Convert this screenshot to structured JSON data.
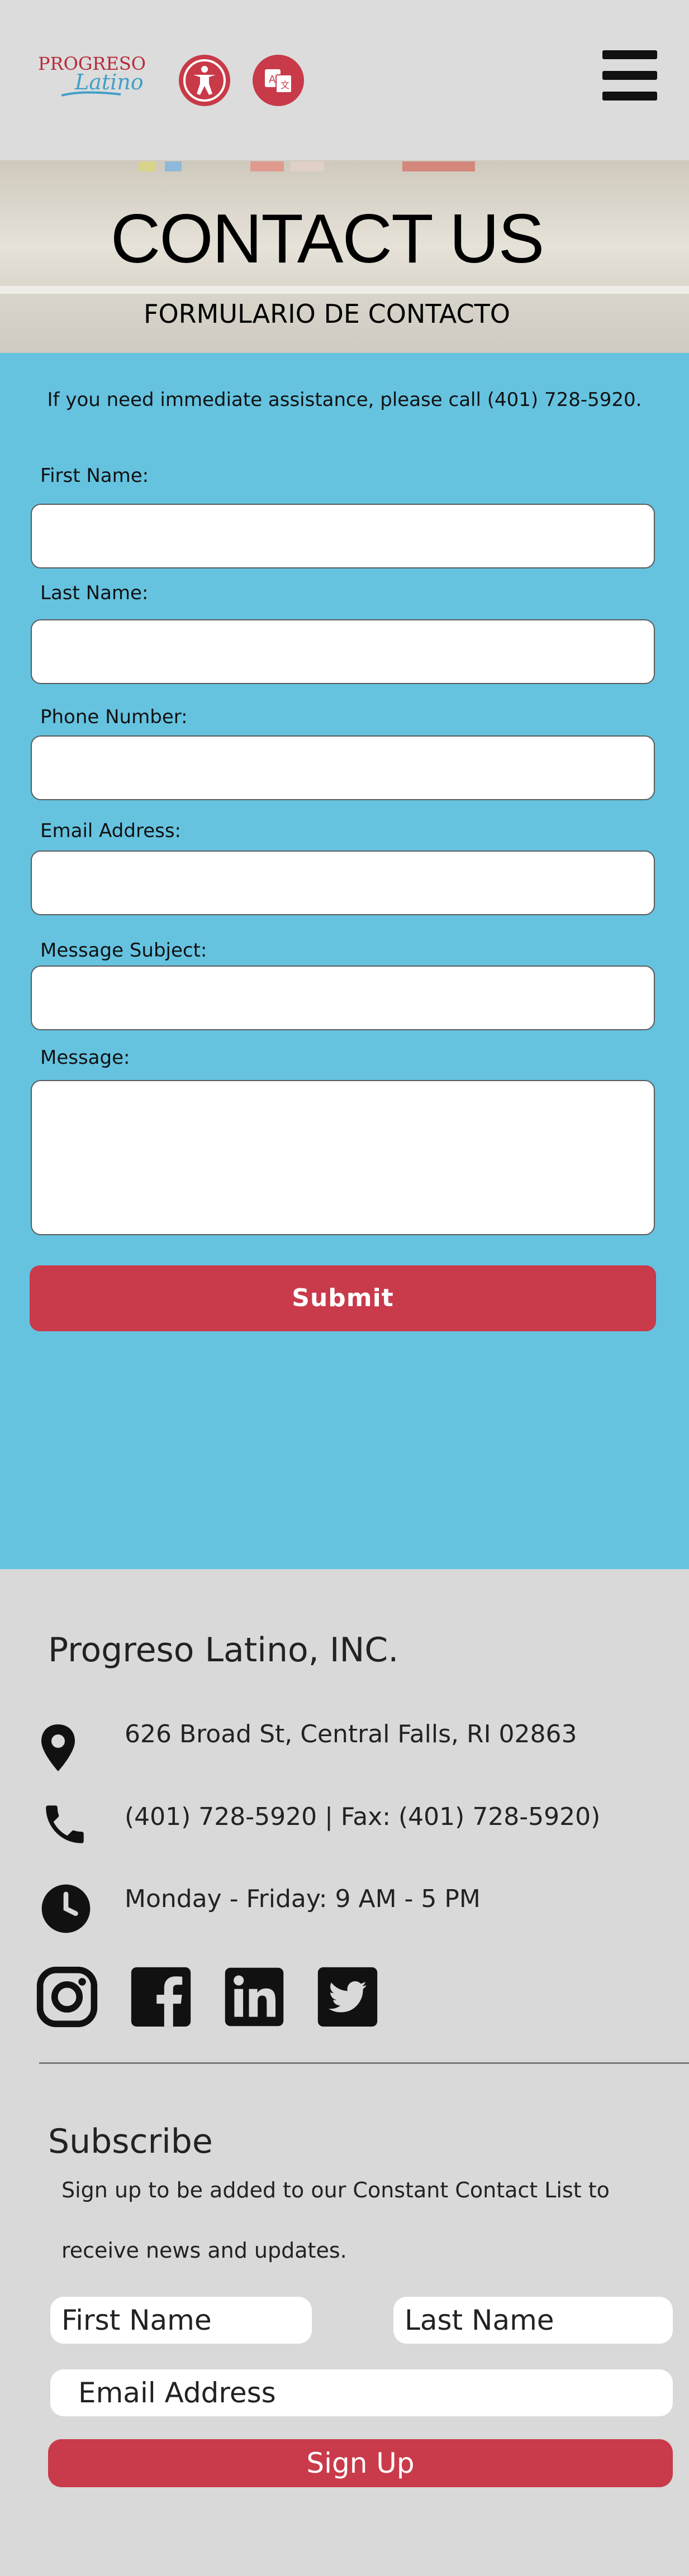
{
  "header": {
    "logo_top": "PROGRESO",
    "logo_bottom": "Latino",
    "accessibility_icon": "accessibility-icon",
    "translate_icon": "translate-icon",
    "menu_icon": "hamburger-menu-icon"
  },
  "hero": {
    "title": "CONTACT US",
    "subtitle": "FORMULARIO DE CONTACTO"
  },
  "form": {
    "intro": "If you need immediate assistance, please call (401) 728-5920.",
    "fields": [
      {
        "label": "First Name:",
        "value": ""
      },
      {
        "label": "Last Name:",
        "value": ""
      },
      {
        "label": "Phone Number:",
        "value": ""
      },
      {
        "label": "Email Address:",
        "value": ""
      },
      {
        "label": "Message Subject:",
        "value": ""
      },
      {
        "label": "Message:",
        "value": ""
      }
    ],
    "submit_label": "Submit"
  },
  "footer": {
    "company": "Progreso Latino, INC.",
    "address": "626 Broad St, Central Falls, RI 02863",
    "phone": "(401) 728-5920 | Fax: (401) 728-5920)",
    "hours": "Monday - Friday: 9 AM - 5 PM",
    "social_icons": [
      "instagram-icon",
      "facebook-icon",
      "linkedin-icon",
      "twitter-icon"
    ],
    "subscribe": {
      "title": "Subscribe",
      "text_line1": "Sign up to be added to our Constant Contact List to",
      "text_line2": "receive news and updates.",
      "first_name_placeholder": "First Name",
      "last_name_placeholder": "Last Name",
      "email_placeholder": "Email Address",
      "button_label": "Sign Up"
    }
  },
  "colors": {
    "brand_red": "#c93a4a",
    "form_bg": "#65c3e0",
    "page_bg": "#d9d9d9"
  }
}
